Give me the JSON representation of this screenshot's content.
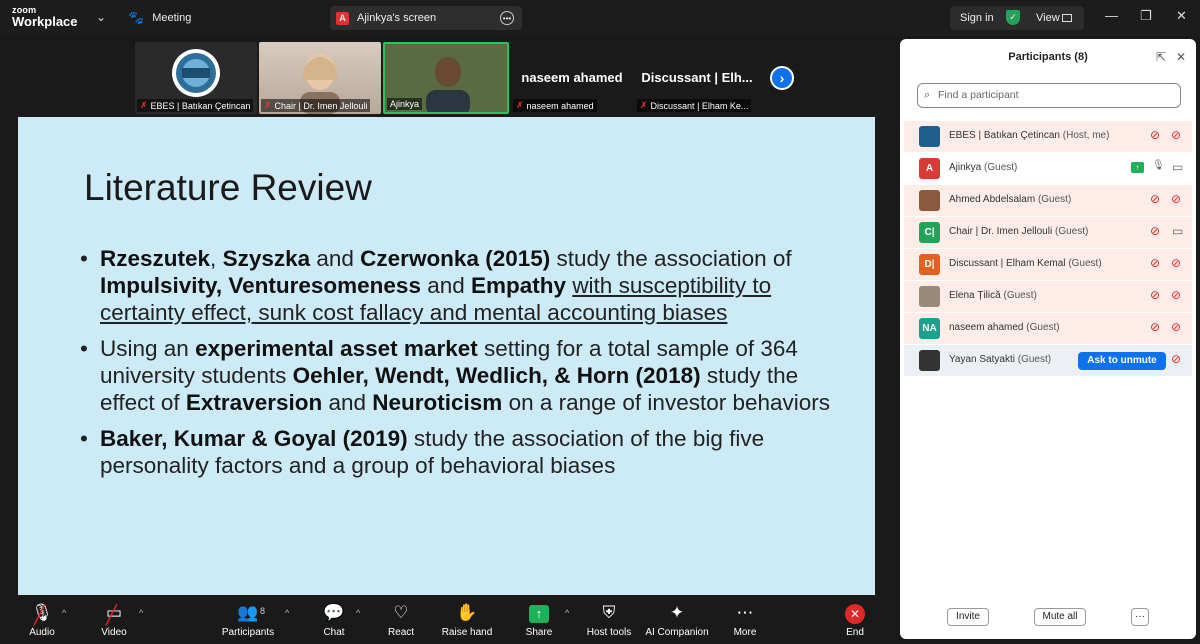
{
  "topbar": {
    "logo_line1": "zoom",
    "logo_line2": "Workplace",
    "meeting_label": "Meeting",
    "screen_tab_badge": "A",
    "screen_tab_label": "Ajinkya's screen",
    "signin_label": "Sign in",
    "view_label": "View"
  },
  "video_strip": {
    "tiles": [
      {
        "name": "EBES | Batıkan Çetincan",
        "logo_text": "EBES"
      },
      {
        "name": "Chair | Dr. Imen Jellouli"
      },
      {
        "name": "Ajinkya"
      },
      {
        "name": "naseem ahamed",
        "big_name": "naseem ahamed"
      },
      {
        "name": "Discussant | Elham Ke...",
        "big_name": "Discussant | Elh..."
      }
    ]
  },
  "slide": {
    "title": "Literature Review",
    "bullets": [
      {
        "parts": [
          {
            "t": "Rzeszutek",
            "s": "b"
          },
          {
            "t": ", ",
            "s": ""
          },
          {
            "t": "Szyszka",
            "s": "b"
          },
          {
            "t": " and ",
            "s": ""
          },
          {
            "t": "Czerwonka (2015)",
            "s": "b"
          },
          {
            "t": " study the association of ",
            "s": ""
          },
          {
            "t": "Impulsivity, Venturesomeness",
            "s": "b"
          },
          {
            "t": " and ",
            "s": ""
          },
          {
            "t": "Empathy",
            "s": "b"
          },
          {
            "t": " ",
            "s": ""
          },
          {
            "t": "with susceptibility to certainty effect, sunk cost fallacy and mental accounting biases",
            "s": "u"
          }
        ]
      },
      {
        "parts": [
          {
            "t": "Using an ",
            "s": ""
          },
          {
            "t": "experimental asset market",
            "s": "b"
          },
          {
            "t": " setting for a total sample of 364 university students ",
            "s": ""
          },
          {
            "t": "Oehler, Wendt, Wedlich, & Horn (2018)",
            "s": "b"
          },
          {
            "t": " study the effect of ",
            "s": ""
          },
          {
            "t": "Extraversion",
            "s": "b"
          },
          {
            "t": " and ",
            "s": ""
          },
          {
            "t": "Neuroticism",
            "s": "b"
          },
          {
            "t": " on a range of investor behaviors",
            "s": ""
          }
        ]
      },
      {
        "parts": [
          {
            "t": "Baker, Kumar & Goyal (2019)",
            "s": "b"
          },
          {
            "t": " study the association of the big five personality factors and a group of behavioral biases",
            "s": ""
          }
        ]
      }
    ]
  },
  "toolbar": {
    "audio": "Audio",
    "video": "Video",
    "participants": "Participants",
    "participants_count": "8",
    "chat": "Chat",
    "react": "React",
    "raise_hand": "Raise hand",
    "share": "Share",
    "host_tools": "Host tools",
    "ai_companion": "AI Companion",
    "more": "More",
    "end": "End"
  },
  "panel": {
    "title": "Participants (8)",
    "search_placeholder": "Find a participant",
    "participants": [
      {
        "name": "EBES | Batıkan Çetincan",
        "role": "(Host, me)",
        "avatar": "",
        "avatar_color": "#1d5e8c",
        "highlight": true
      },
      {
        "name": "Ajinkya",
        "role": "(Guest)",
        "avatar": "A",
        "avatar_color": "#d93a36",
        "highlight": false
      },
      {
        "name": "Ahmed Abdelsalam",
        "role": "(Guest)",
        "avatar": "",
        "avatar_color": "#8a5a3c",
        "highlight": true
      },
      {
        "name": "Chair | Dr. Imen Jellouli",
        "role": "(Guest)",
        "avatar": "C|",
        "avatar_color": "#23a35a",
        "highlight": true
      },
      {
        "name": "Discussant | Elham Kemal",
        "role": "(Guest)",
        "avatar": "D|",
        "avatar_color": "#e0621e",
        "highlight": true
      },
      {
        "name": "Elena Țilică",
        "role": "(Guest)",
        "avatar": "",
        "avatar_color": "#9a8a7a",
        "highlight": true
      },
      {
        "name": "naseem ahamed",
        "role": "(Guest)",
        "avatar": "NA",
        "avatar_color": "#1aa08c",
        "highlight": true
      },
      {
        "name": "Yayan Satyakti",
        "role": "(Guest)",
        "avatar": "",
        "avatar_color": "#333333",
        "highlight": false
      }
    ],
    "ask_to_unmute": "Ask to unmute",
    "invite": "Invite",
    "mute_all": "Mute all",
    "more": "···"
  }
}
